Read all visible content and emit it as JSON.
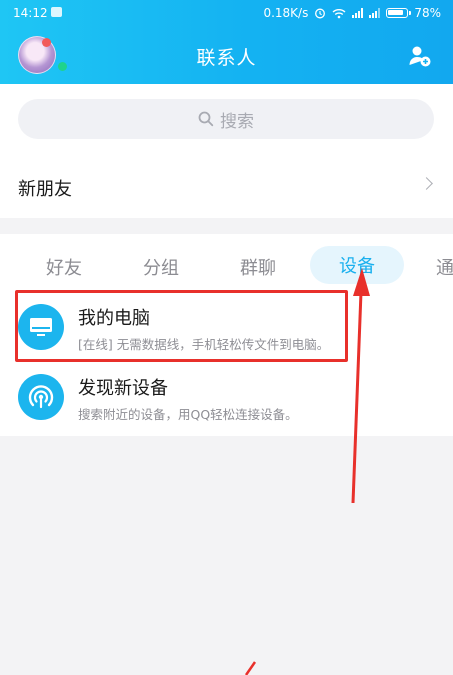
{
  "status_bar": {
    "time": "14:12",
    "speed": "0.18K/s",
    "battery": "78%"
  },
  "header": {
    "title": "联系人"
  },
  "search": {
    "placeholder": "搜索"
  },
  "new_friends": {
    "label": "新朋友"
  },
  "tabs": [
    {
      "label": "好友"
    },
    {
      "label": "分组"
    },
    {
      "label": "群聊"
    },
    {
      "label": "设备",
      "active": true
    },
    {
      "label": "通"
    }
  ],
  "devices": [
    {
      "title": "我的电脑",
      "subtitle": "[在线] 无需数据线，手机轻松传文件到电脑。",
      "icon": "computer-icon"
    },
    {
      "title": "发现新设备",
      "subtitle": "搜索附近的设备，用QQ轻松连接设备。",
      "icon": "radar-icon"
    }
  ],
  "colors": {
    "header": "#14b2f2",
    "accent": "#1ab0ee",
    "annotation": "#e8302b"
  }
}
